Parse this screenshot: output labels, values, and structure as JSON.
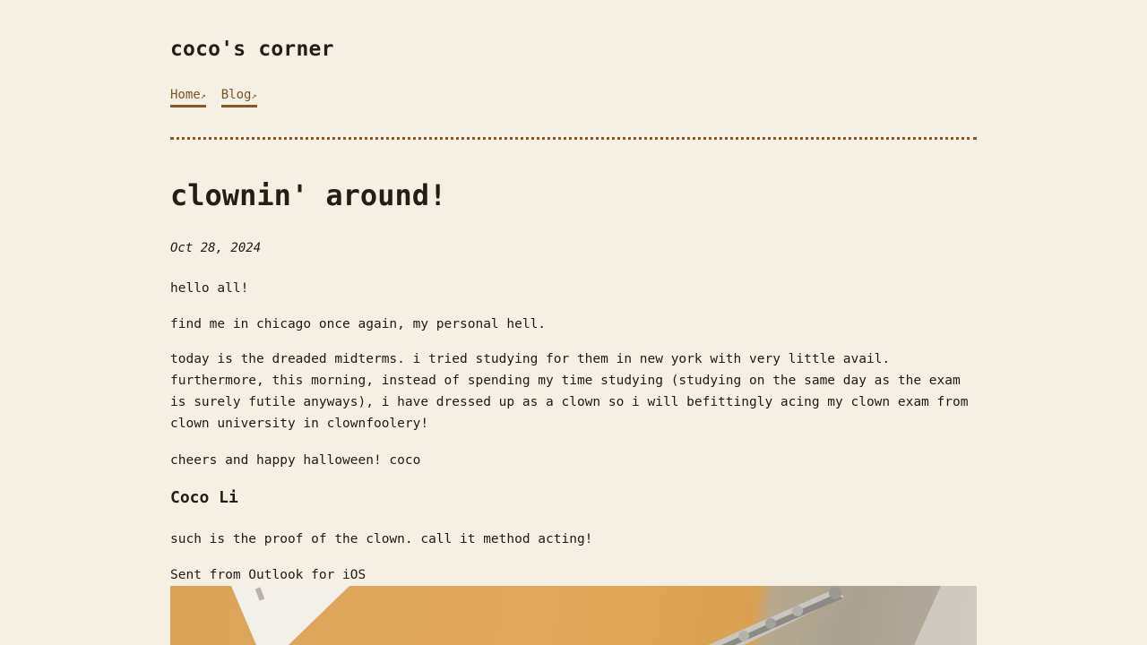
{
  "site": {
    "title": "coco's corner"
  },
  "nav": {
    "items": [
      {
        "label": "Home",
        "arrow": "↗"
      },
      {
        "label": "Blog",
        "arrow": "↗"
      }
    ]
  },
  "post": {
    "title": "clownin' around!",
    "date": "Oct 28, 2024",
    "paragraphs": [
      "hello all!",
      "find me in chicago once again, my personal hell.",
      "today is the dreaded midterms. i tried studying for them in new york with very little avail. furthermore, this morning, instead of spending my time studying (studying on the same day as the exam is surely futile anyways), i have dressed up as a clown so i will befittingly acing my clown exam from clown university in clownfoolery!",
      "cheers and happy halloween! coco"
    ],
    "author": "Coco Li",
    "author_paragraphs": [
      "such is the proof of the clown. call it method acting!",
      "Sent from Outlook for iOS"
    ]
  },
  "colors": {
    "background": "#f6f0e4",
    "link": "#7d5126",
    "accent": "#8a5529",
    "text": "#1e1a14"
  }
}
